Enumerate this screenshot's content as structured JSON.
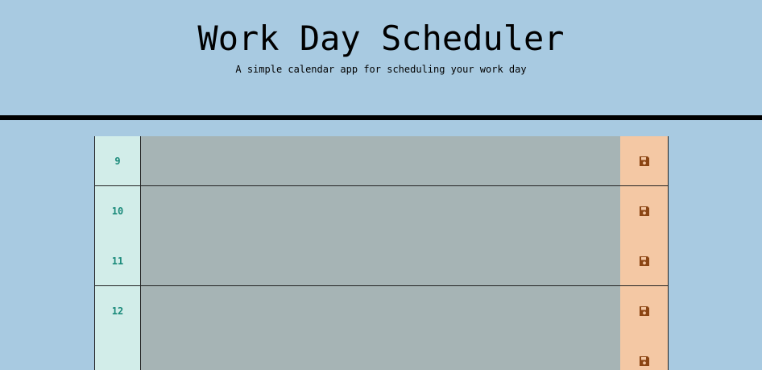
{
  "header": {
    "title": "Work Day Scheduler",
    "subtitle": "A simple calendar app for scheduling your work day"
  },
  "schedule": {
    "rows": [
      {
        "hour": "9",
        "text": ""
      },
      {
        "hour": "10",
        "text": ""
      },
      {
        "hour": "11",
        "text": ""
      },
      {
        "hour": "12",
        "text": ""
      },
      {
        "hour": "",
        "text": ""
      }
    ],
    "save_icon": "floppy-disk-icon"
  },
  "colors": {
    "background": "#a8cae1",
    "hour_bg": "#d2ede9",
    "hour_text": "#1a8a7a",
    "entry_bg": "#a6b4b5",
    "save_bg": "#f4c8a4",
    "save_icon": "#8b4513"
  }
}
